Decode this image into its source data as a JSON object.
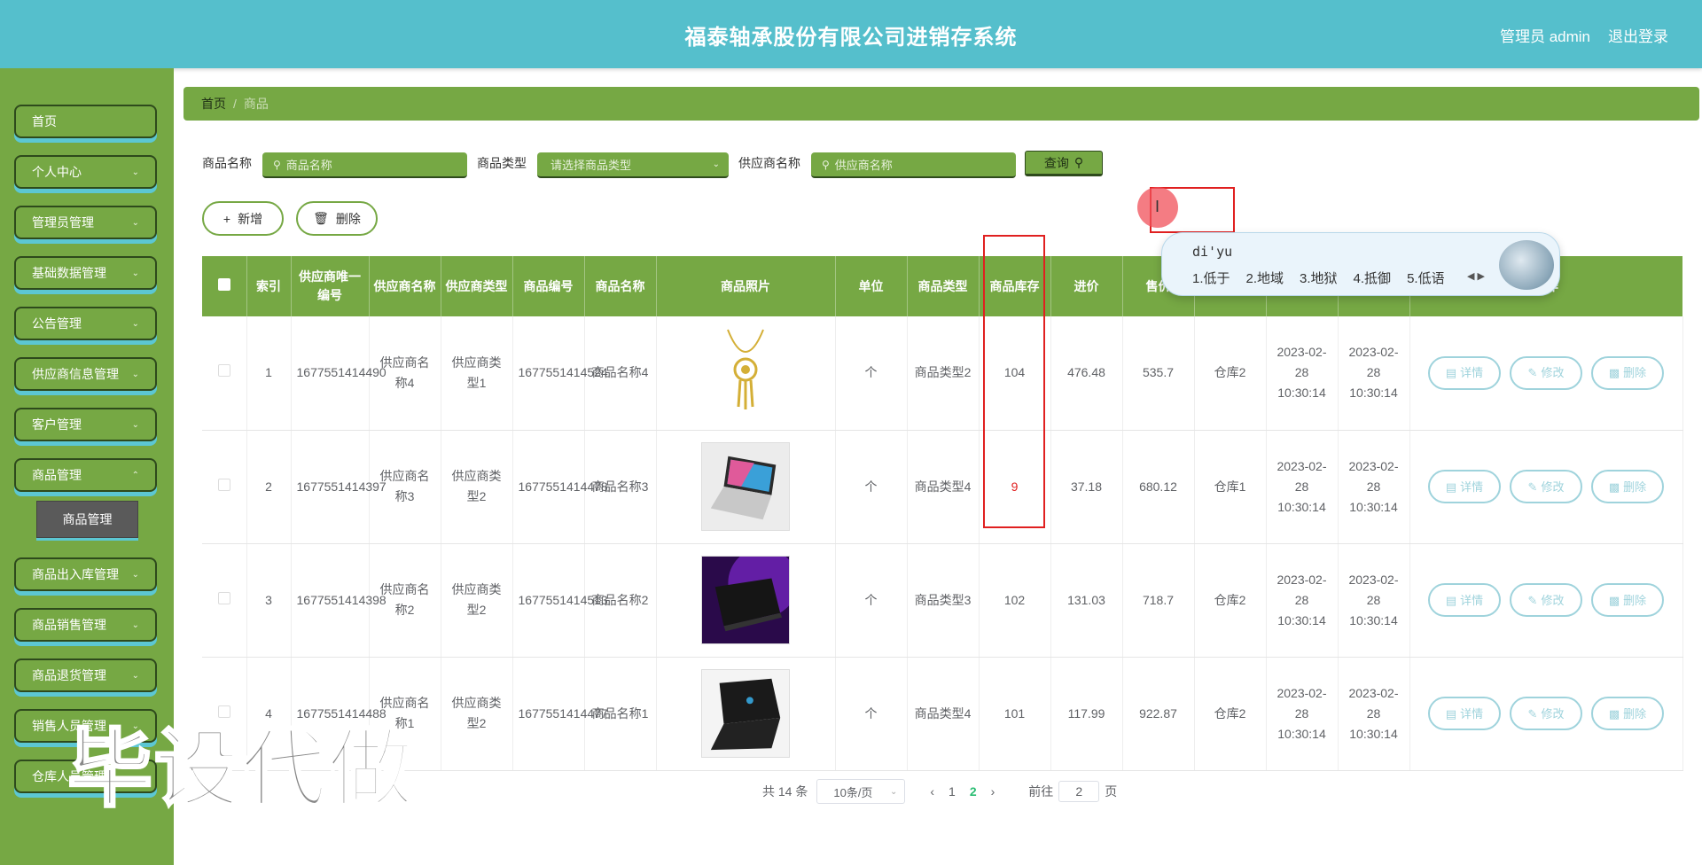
{
  "header": {
    "title": "福泰轴承股份有限公司进销存系统",
    "user": "管理员 admin",
    "logout": "退出登录"
  },
  "sidebar": {
    "items": [
      {
        "label": "首页"
      },
      {
        "label": "个人中心"
      },
      {
        "label": "管理员管理"
      },
      {
        "label": "基础数据管理"
      },
      {
        "label": "公告管理"
      },
      {
        "label": "供应商信息管理"
      },
      {
        "label": "客户管理"
      },
      {
        "label": "商品管理"
      },
      {
        "label": "商品出入库管理"
      },
      {
        "label": "商品销售管理"
      },
      {
        "label": "商品退货管理"
      },
      {
        "label": "销售人员管理"
      },
      {
        "label": "仓库人员管理"
      }
    ],
    "sub_item": "商品管理"
  },
  "breadcrumb": {
    "home": "首页",
    "sep": "/",
    "current": "商品"
  },
  "search": {
    "name_label": "商品名称",
    "name_placeholder": "商品名称",
    "type_label": "商品类型",
    "type_placeholder": "请选择商品类型",
    "supplier_label": "供应商名称",
    "supplier_placeholder": "供应商名称",
    "query_label": "查询"
  },
  "actions": {
    "add": "新增",
    "delete": "删除"
  },
  "table": {
    "columns": [
      "索引",
      "供应商唯一编号",
      "供应商名称",
      "供应商类型",
      "商品编号",
      "商品名称",
      "商品照片",
      "单位",
      "商品类型",
      "商品库存",
      "进价",
      "售价",
      "",
      "",
      "",
      "操作"
    ],
    "rows": [
      {
        "idx": "1",
        "sup_no": "1677551414490",
        "sup_name": "供应商名称4",
        "sup_type": "供应商类型1",
        "goods_no": "1677551414524",
        "goods_name": "商品名称4",
        "unit": "个",
        "goods_type": "商品类型2",
        "stock": "104",
        "cost": "476.48",
        "price": "535.7",
        "warehouse": "仓库2",
        "time1": "2023-02-28 10:30:14",
        "time2": "2023-02-28 10:30:14"
      },
      {
        "idx": "2",
        "sup_no": "1677551414397",
        "sup_name": "供应商名称3",
        "sup_type": "供应商类型2",
        "goods_no": "1677551414478",
        "goods_name": "商品名称3",
        "unit": "个",
        "goods_type": "商品类型4",
        "stock": "9",
        "cost": "37.18",
        "price": "680.12",
        "warehouse": "仓库1",
        "time1": "2023-02-28 10:30:14",
        "time2": "2023-02-28 10:30:14"
      },
      {
        "idx": "3",
        "sup_no": "1677551414398",
        "sup_name": "供应商名称2",
        "sup_type": "供应商类型2",
        "goods_no": "1677551414513",
        "goods_name": "商品名称2",
        "unit": "个",
        "goods_type": "商品类型3",
        "stock": "102",
        "cost": "131.03",
        "price": "718.7",
        "warehouse": "仓库2",
        "time1": "2023-02-28 10:30:14",
        "time2": "2023-02-28 10:30:14"
      },
      {
        "idx": "4",
        "sup_no": "1677551414488",
        "sup_name": "供应商名称1",
        "sup_type": "供应商类型2",
        "goods_no": "1677551414477",
        "goods_name": "商品名称1",
        "unit": "个",
        "goods_type": "商品类型4",
        "stock": "101",
        "cost": "117.99",
        "price": "922.87",
        "warehouse": "仓库2",
        "time1": "2023-02-28 10:30:14",
        "time2": "2023-02-28 10:30:14"
      }
    ],
    "ops": {
      "detail": "详情",
      "edit": "修改",
      "delete": "删除"
    }
  },
  "pager": {
    "total": "共 14 条",
    "page_size": "10条/页",
    "pages": [
      "1",
      "2"
    ],
    "goto_label": "前往",
    "goto_value": "2",
    "goto_suffix": "页"
  },
  "ime": {
    "composition": "di'yu",
    "candidates": [
      "1.低于",
      "2.地域",
      "3.地狱",
      "4.抵御",
      "5.低语"
    ]
  },
  "watermark": "毕设代做",
  "colors": {
    "header": "#55bfcc",
    "sidebar": "#76a844",
    "highlight": "#e02020"
  }
}
